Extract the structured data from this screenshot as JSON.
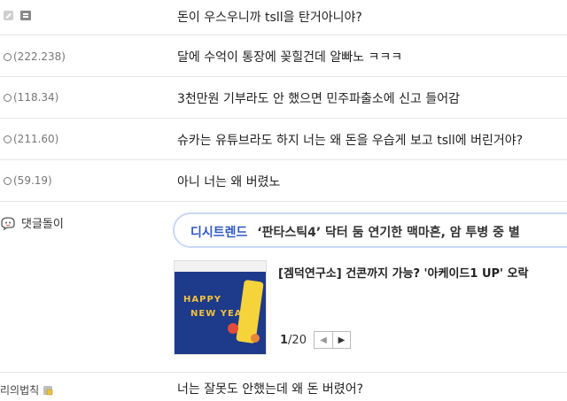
{
  "comments": [
    {
      "nick": "",
      "icon": "ban-icon",
      "icon2": "doc-icon",
      "text": "돈이 우스우니까 tsll을 탄거아니야?"
    },
    {
      "nick": "(222.238)",
      "text": "달에 수억이 통장에 꽂힐건데 알빠노 ㅋㅋㅋ"
    },
    {
      "nick": "(118.34)",
      "text": "3천만원 기부라도 안 했으면 민주파출소에 신고 들어감"
    },
    {
      "nick": "(211.60)",
      "text": "슈카는 유튜브라도 하지 너는 왜 돈을 우습게 보고 tsll에 버린거야?"
    },
    {
      "nick": "(59.19)",
      "text": "아니 너는 왜 버렸노"
    }
  ],
  "bot": {
    "name": "댓글돌이",
    "trend_tag": "디시트렌드",
    "trend_text": "‘판타스틱4’ 닥터 둠 연기한 맥마흔, 암 투병 중 별",
    "card_title": "[겜덕연구소] 건콘까지 가능? '아케이드1 UP' 오락",
    "thumb_line1": "HAPPY",
    "thumb_line2": "NEW YEAR",
    "page_current": "1",
    "page_total": "/20",
    "prev_glyph": "◀",
    "next_glyph": "▶"
  },
  "last_comment": {
    "nick": "리의법칙",
    "text": "너는 잘못도 안했는데 왜 돈 버렸어?"
  }
}
